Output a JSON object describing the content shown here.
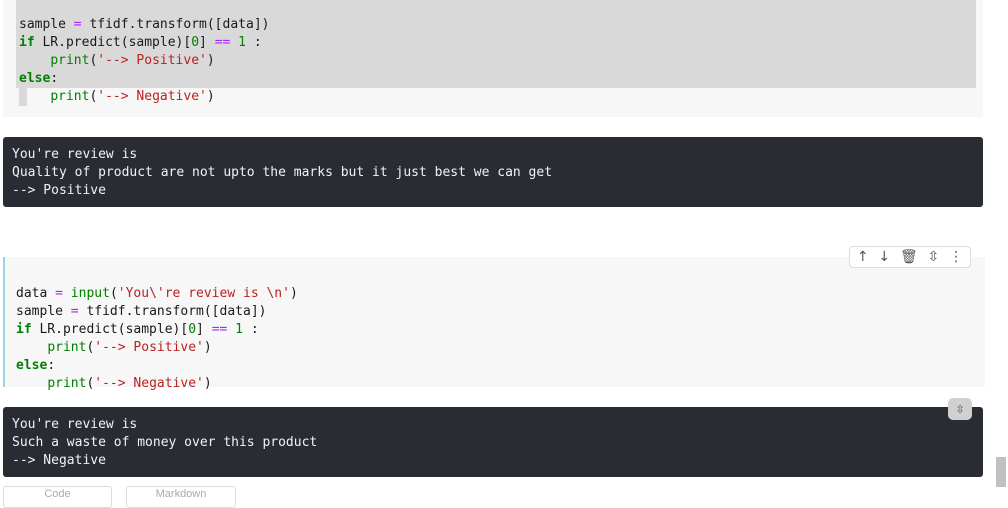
{
  "cell1": {
    "lines": [
      [
        "sample ",
        "= ",
        "tfidf.transform([data])"
      ],
      [
        "if ",
        "LR.predict(sample)[",
        "0",
        "] ",
        "==",
        " ",
        "1",
        " :"
      ],
      [
        "    ",
        "print",
        "(",
        "'--> Positive'",
        ")"
      ],
      [
        "else",
        ":"
      ],
      [
        "    ",
        "print",
        "(",
        "'--> Negative'",
        ")"
      ]
    ]
  },
  "output1": {
    "lines": [
      "You're review is",
      "Quality of product are not upto the marks but it just best we can get",
      "--> Positive"
    ]
  },
  "cell2": {
    "lines": [
      [
        "data ",
        "= ",
        "input",
        "(",
        "'You\\'re review is \\n'",
        ")"
      ],
      [
        "sample ",
        "= ",
        "tfidf.transform([data])"
      ],
      [
        "if ",
        "LR.predict(sample)[",
        "0",
        "] ",
        "==",
        " ",
        "1",
        " :"
      ],
      [
        "    ",
        "print",
        "(",
        "'--> Positive'",
        ")"
      ],
      [
        "else",
        ":"
      ],
      [
        "    ",
        "print",
        "(",
        "'--> Negative'",
        ")"
      ]
    ]
  },
  "toolbar": {
    "icons": [
      "move-up-icon",
      "move-down-icon",
      "delete-icon",
      "collapse-icon",
      "more-icon"
    ],
    "glyphs": [
      "↑",
      "↓",
      "🗑",
      "⇳",
      "⋮"
    ]
  },
  "output2": {
    "lines": [
      "You're review is",
      "Such a waste of money over this product",
      "--> Negative"
    ]
  },
  "add_buttons": {
    "code_label": "Code",
    "markdown_label": "Markdown"
  }
}
